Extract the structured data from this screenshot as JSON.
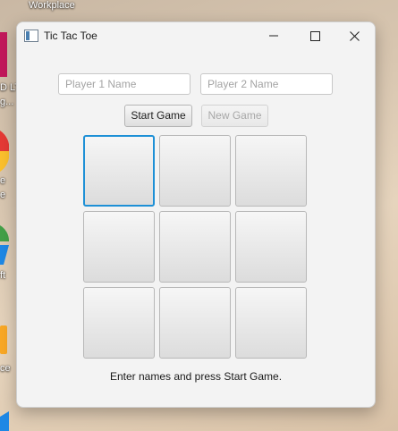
{
  "desktop": {
    "top_label": "Workplace",
    "left_labels": [
      "D LT",
      "g...",
      "e",
      "e",
      "ft",
      "ce"
    ]
  },
  "window": {
    "title": "Tic Tac Toe",
    "controls": {
      "minimize": "minimize-icon",
      "maximize": "maximize-icon",
      "close": "close-icon"
    }
  },
  "inputs": {
    "player1": {
      "placeholder": "Player 1 Name",
      "value": ""
    },
    "player2": {
      "placeholder": "Player 2 Name",
      "value": ""
    }
  },
  "buttons": {
    "start": "Start Game",
    "new_game": "New Game",
    "new_game_enabled": false
  },
  "board": {
    "cells": [
      "",
      "",
      "",
      "",
      "",
      "",
      "",
      "",
      ""
    ],
    "focused_index": 0
  },
  "status": "Enter names and press Start Game.",
  "colors": {
    "focus": "#1e90d6",
    "window_bg": "#f3f3f3"
  }
}
